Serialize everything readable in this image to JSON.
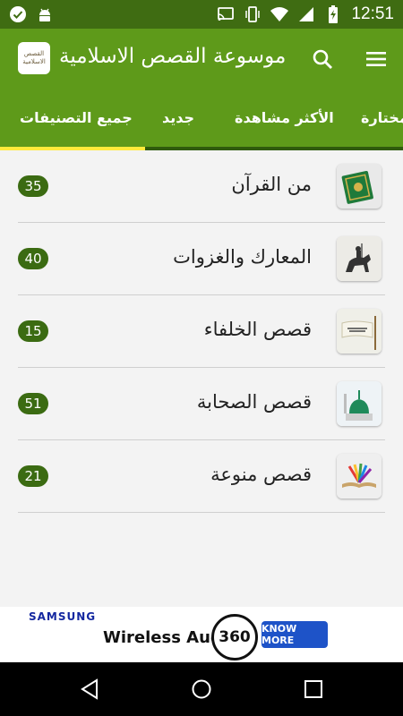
{
  "status_bar": {
    "time": "12:51",
    "icons": [
      "check-circle-icon",
      "android-icon",
      "cast-icon",
      "vibrate-icon",
      "wifi-icon",
      "signal-icon",
      "battery-icon"
    ]
  },
  "app_bar": {
    "title": "موسوعة القصص الاسلامية",
    "logo_text": "القصص الاسلامية",
    "icons": [
      "search-icon",
      "menu-icon"
    ]
  },
  "tabs": [
    {
      "label": "جميع التصنيفات",
      "active": true
    },
    {
      "label": "جديد",
      "active": false
    },
    {
      "label": "الأكثر مشاهدة",
      "active": false
    },
    {
      "label": "مختارة",
      "active": false
    }
  ],
  "categories": [
    {
      "label": "من القرآن",
      "count": "35",
      "icon": "quran-book-icon"
    },
    {
      "label": "المعارك والغزوات",
      "count": "40",
      "icon": "horseman-icon"
    },
    {
      "label": "قصص الخلفاء",
      "count": "15",
      "icon": "flag-icon"
    },
    {
      "label": "قصص الصحابة",
      "count": "51",
      "icon": "mosque-dome-icon"
    },
    {
      "label": "قصص منوعة",
      "count": "21",
      "icon": "open-book-icon"
    }
  ],
  "ad": {
    "brand": "SAMSUNG",
    "headline": "Wireless Audio",
    "badge": "360",
    "cta": "KNOW MORE"
  },
  "nav_bar": {
    "icons": [
      "back-icon",
      "home-icon",
      "recents-icon"
    ]
  },
  "colors": {
    "status_bar": "#3f6c12",
    "app_bar": "#5e9a1a",
    "tab_indicator": "#ffeb3b",
    "badge": "#3b6b12"
  }
}
